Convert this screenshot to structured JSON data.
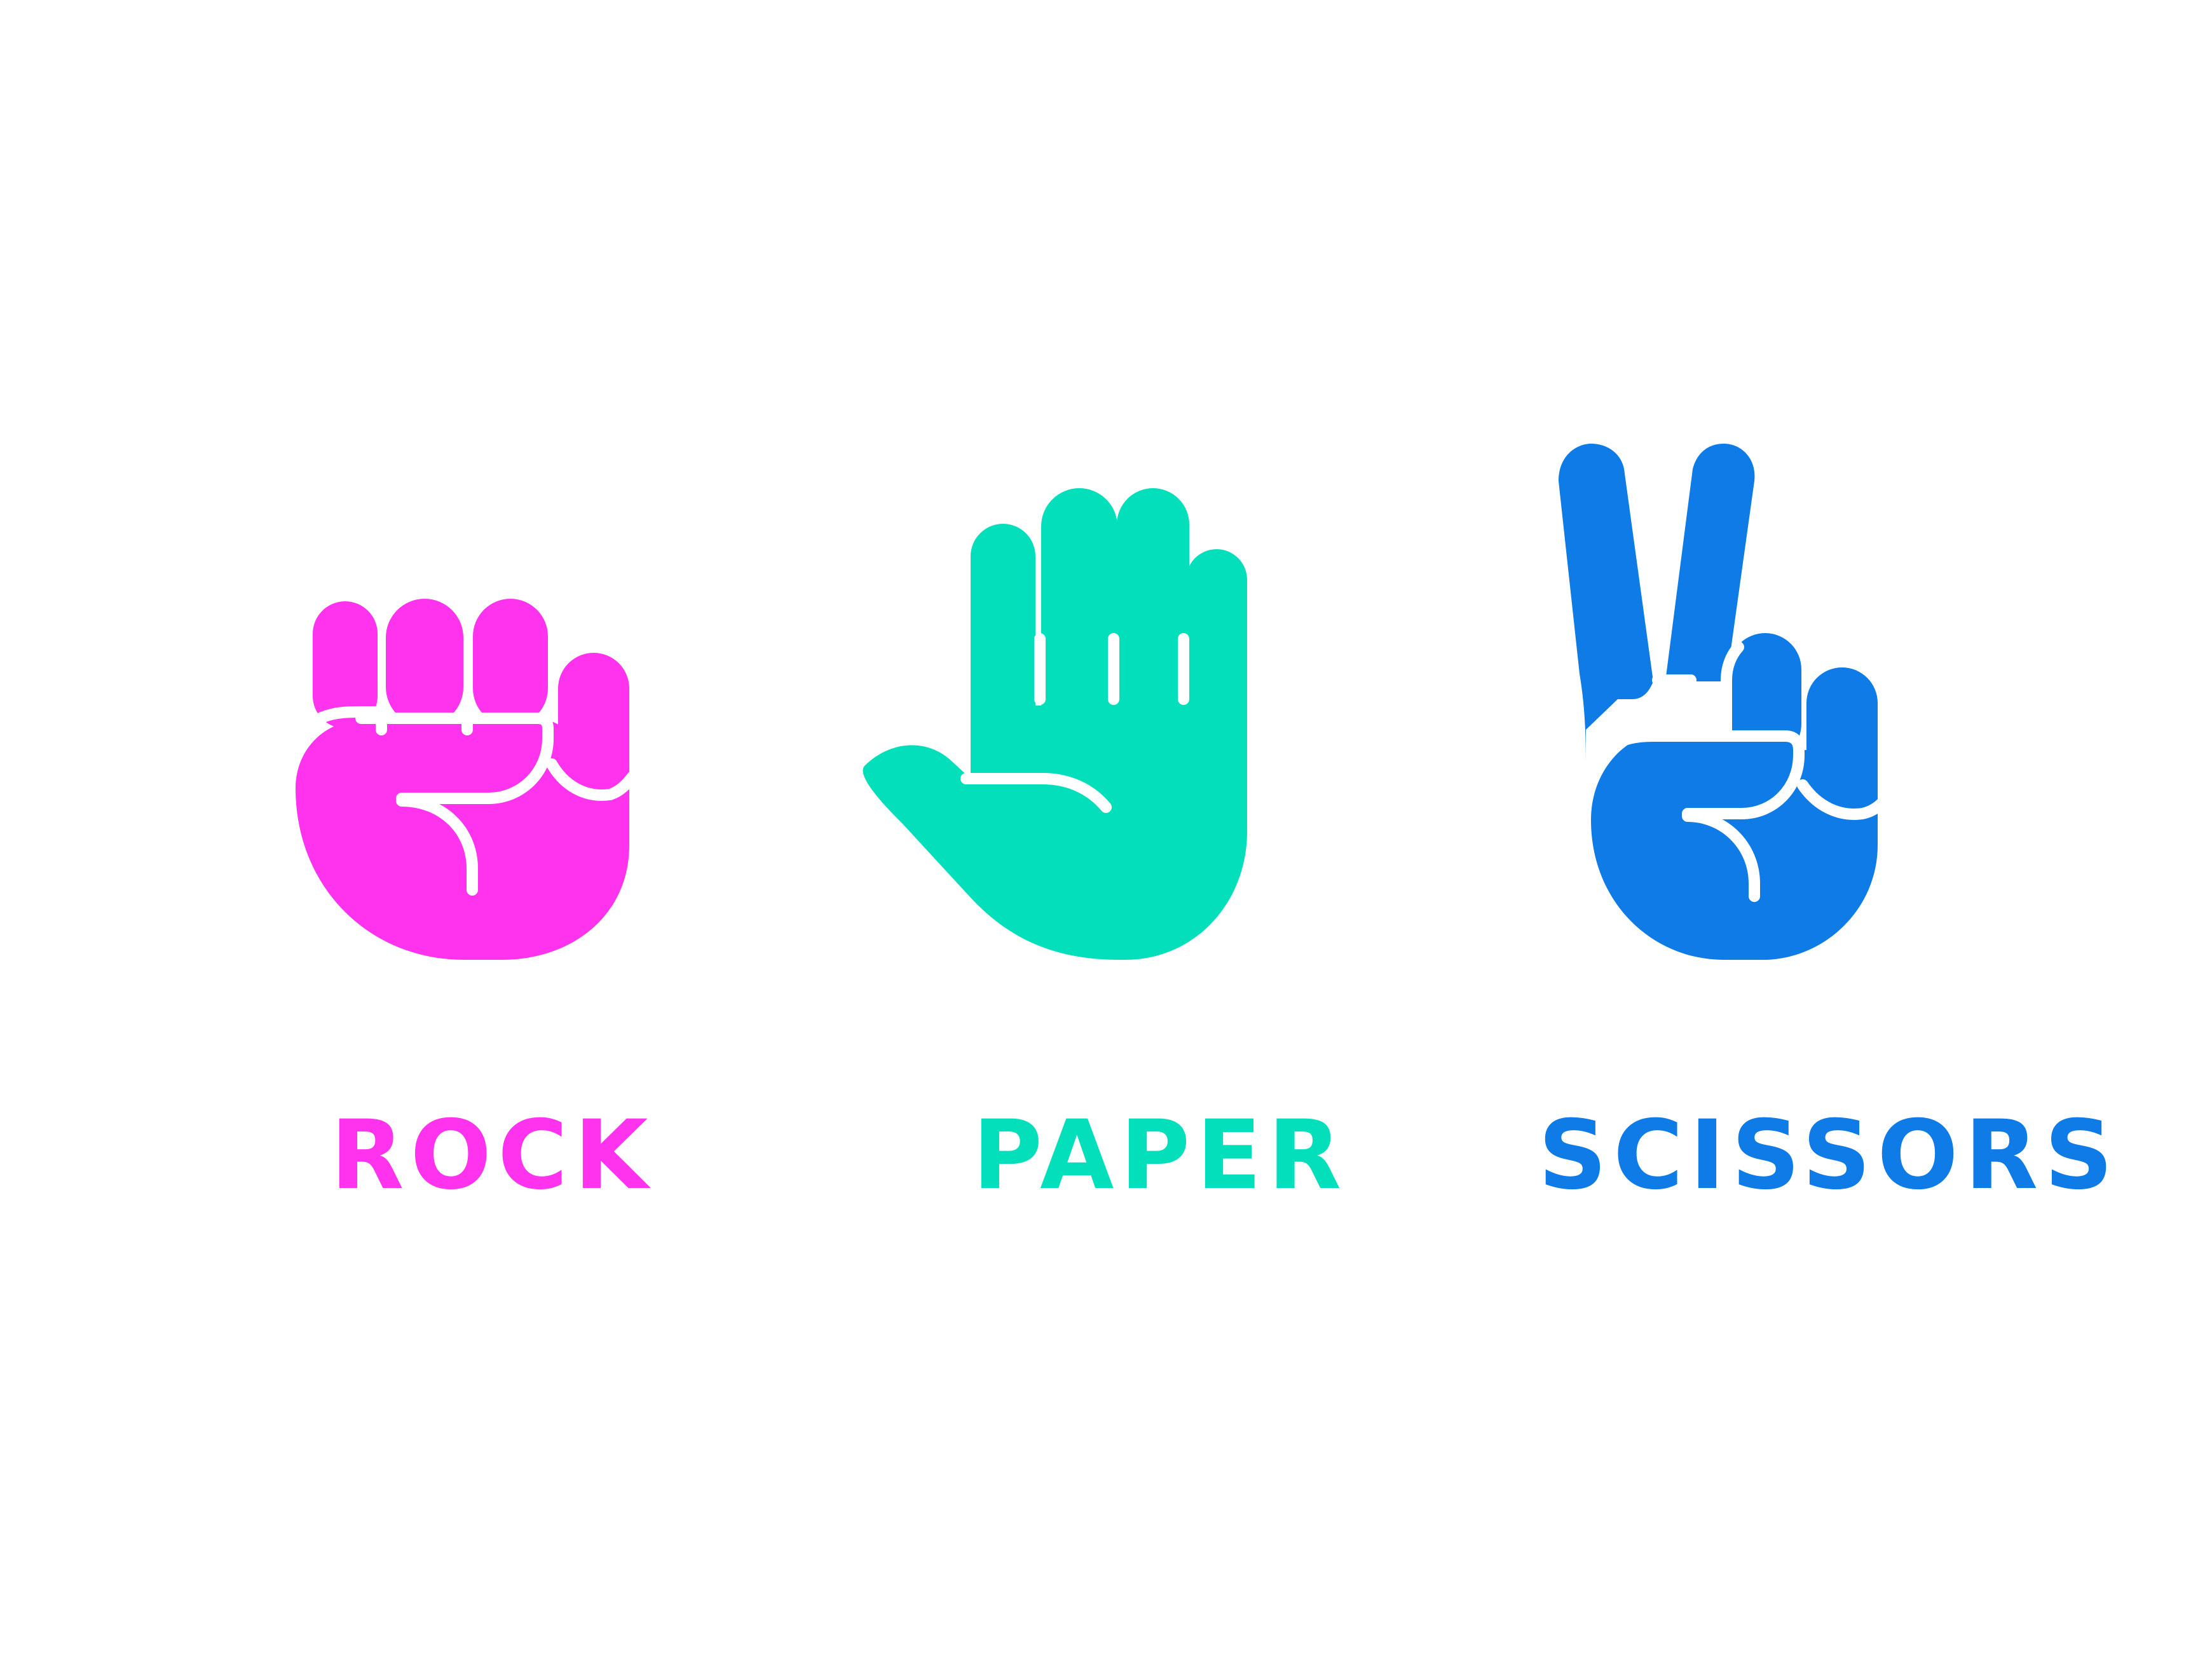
{
  "gestures": [
    {
      "id": "rock",
      "label": "ROCK",
      "icon": "fist-icon",
      "color": "#FF33EE"
    },
    {
      "id": "paper",
      "label": "PAPER",
      "icon": "open-hand-icon",
      "color": "#04DFBB"
    },
    {
      "id": "scissors",
      "label": "SCISSORS",
      "icon": "peace-sign-icon",
      "color": "#0E7BE6"
    }
  ]
}
